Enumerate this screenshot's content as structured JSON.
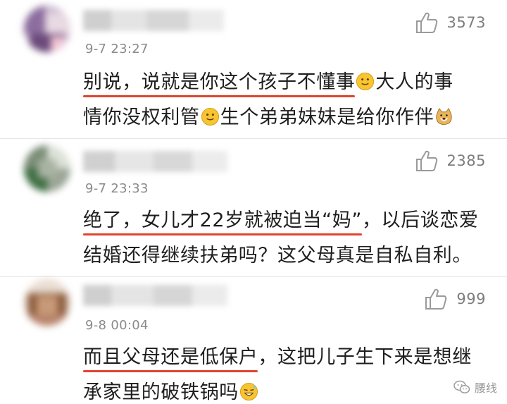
{
  "comments": [
    {
      "timestamp": "9-7 23:27",
      "likes": "3573",
      "line1_underlined": "别说，说就是你这个孩子不懂事",
      "line1_rest": "大人的事",
      "line2_a": "情你没权利管",
      "line2_b": "生个弟弟妹妹是给你作伴",
      "emojis": [
        "smile-emoji",
        "smile-emoji",
        "doge-emoji"
      ]
    },
    {
      "timestamp": "9-7 23:33",
      "likes": "2385",
      "line1_underlined": "绝了，女儿才22岁就被迫当“妈”",
      "line1_rest": "，以后谈恋爱",
      "line2": "结婚还得继续扶弟吗？这父母真是自私自利。"
    },
    {
      "timestamp": "9-8 00:04",
      "likes": "999",
      "line1_underlined": "而且父母还是低保户",
      "line1_rest": "，这把儿子生下来是想继",
      "line2": "承家里的破铁锅吗",
      "emojis": [
        "sweat-smile-emoji"
      ]
    }
  ],
  "watermark": {
    "label": "腰线",
    "icon": "wechat-icon"
  },
  "colors": {
    "underline": "#e0452e",
    "meta_text": "#8a8a8a",
    "body_text": "#1e1e1e"
  }
}
